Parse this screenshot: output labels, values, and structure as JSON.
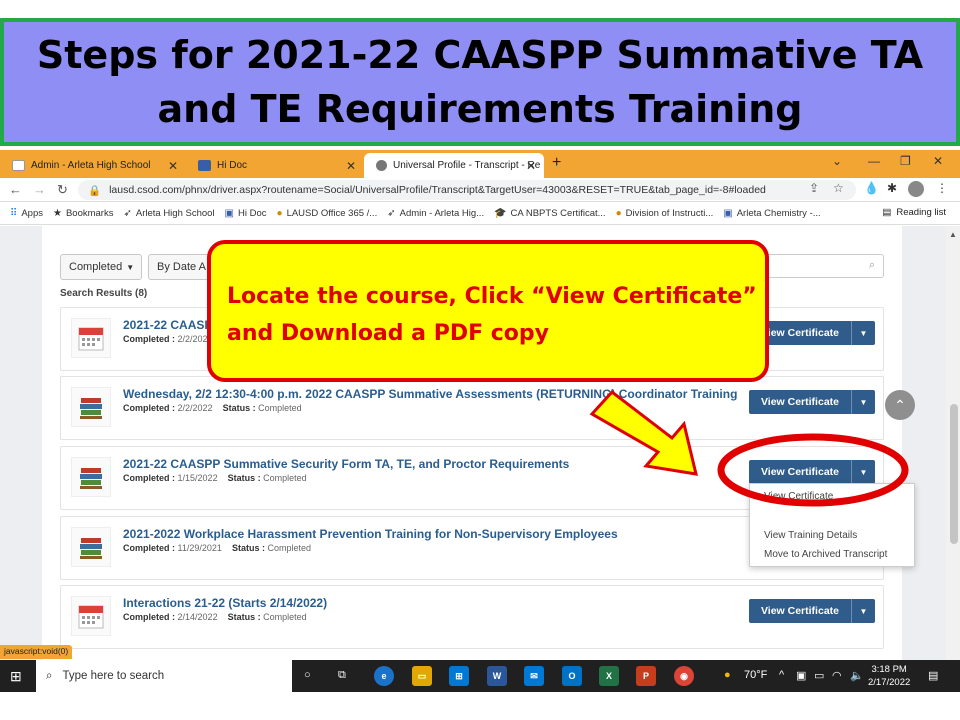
{
  "slide": {
    "title": "Steps for 2021-22 CAASPP Summative TA and TE Requirements Training"
  },
  "browser": {
    "tabs": [
      {
        "label": "Admin - Arleta High School",
        "icon": "eagle-icon"
      },
      {
        "label": "Hi Doc",
        "icon": "doc-icon"
      },
      {
        "label": "Universal Profile - Transcript - Re",
        "icon": "globe-icon"
      }
    ],
    "url": "lausd.csod.com/phnx/driver.aspx?routename=Social/UniversalProfile/Transcript&TargetUser=43003&RESET=TRUE&tab_page_id=-8#loaded",
    "bookmarks": [
      "Apps",
      "Bookmarks",
      "Arleta High School",
      "Hi Doc",
      "LAUSD Office 365 /...",
      "Admin - Arleta Hig...",
      "CA NBPTS Certificat...",
      "Division of Instructi...",
      "Arleta Chemistry -..."
    ],
    "reading_list": "Reading list",
    "status_link": "javascript:void(0)"
  },
  "transcript": {
    "filter_status": "Completed",
    "filter_date": "By Date A",
    "search_placeholder": "ng",
    "results_count": "Search Results (8)",
    "completed_label": "Completed :",
    "status_label": "Status :",
    "rows": [
      {
        "title": "2021-22 CAASP",
        "completed": "2/2/202",
        "status": "",
        "button": "View Certificate"
      },
      {
        "title": "Wednesday, 2/2 12:30-4:00 p.m. 2022 CAASPP Summative Assessments (RETURNING) Coordinator Training",
        "completed": "2/2/2022",
        "status": "Completed",
        "button": "View Certificate"
      },
      {
        "title": "2021-22 CAASPP Summative Security Form TA, TE, and Proctor Requirements",
        "completed": "1/15/2022",
        "status": "Completed",
        "button": "View Certificate"
      },
      {
        "title": "2021-2022 Workplace Harassment Prevention Training for Non-Supervisory Employees",
        "completed": "11/29/2021",
        "status": "Completed",
        "button": ""
      },
      {
        "title": "Interactions 21-22 (Starts 2/14/2022)",
        "completed": "2/14/2022",
        "status": "Completed",
        "button": "View Certificate"
      }
    ],
    "dropdown": [
      "View Certificate",
      "View Training Details",
      "Move to Archived Transcript"
    ]
  },
  "callout": {
    "text": "Locate the course, Click “View Certificate” and Download a PDF copy",
    "colors": {
      "fill": "#ffff00",
      "border": "#e00000",
      "text": "#e00000"
    }
  },
  "taskbar": {
    "search_placeholder": "Type here to search",
    "temperature": "70°F",
    "time": "3:18 PM",
    "date": "2/17/2022"
  }
}
